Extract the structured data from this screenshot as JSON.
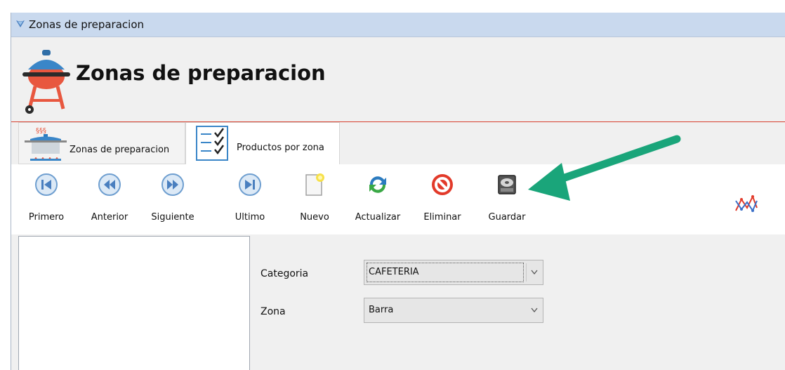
{
  "window": {
    "title": "Zonas de preparacion"
  },
  "header": {
    "title": "Zonas de preparacion"
  },
  "tabs": [
    {
      "label": "Zonas de preparacion",
      "active": false
    },
    {
      "label": "Productos por zona",
      "active": true
    }
  ],
  "toolbar": {
    "first": "Primero",
    "prev": "Anterior",
    "next": "Siguiente",
    "last": "Ultimo",
    "new": "Nuevo",
    "refresh": "Actualizar",
    "delete": "Eliminar",
    "save": "Guardar"
  },
  "form": {
    "categoria_label": "Categoria",
    "categoria_value": "CAFETERIA",
    "zona_label": "Zona",
    "zona_value": "Barra"
  },
  "colors": {
    "accent_line": "#d8412f",
    "nav_blue": "#6f9fd0",
    "annotation_arrow": "#1aa57a"
  },
  "icons": [
    "barbecue-grill-icon",
    "cooking-pot-icon",
    "checklist-icon",
    "first-record-icon",
    "previous-record-icon",
    "next-record-icon",
    "last-record-icon",
    "new-document-icon",
    "refresh-icon",
    "delete-icon",
    "save-disk-icon",
    "line-chart-icon"
  ]
}
